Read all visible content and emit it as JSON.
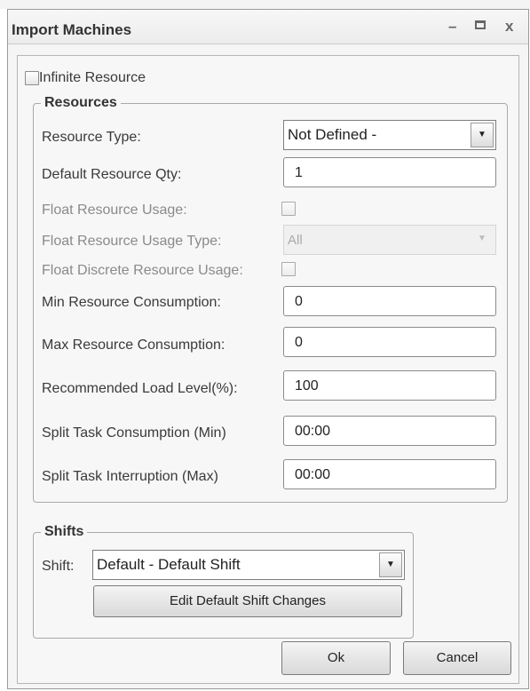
{
  "window": {
    "title": "Import Machines",
    "minimize_glyph": "–",
    "close_glyph": "x"
  },
  "infinite_resource": {
    "label": "Infinite Resource",
    "checked": false
  },
  "resources": {
    "legend": "Resources",
    "resource_type": {
      "label": "Resource Type:",
      "value": "Not Defined -"
    },
    "default_resource_qty": {
      "label": "Default Resource Qty:",
      "value": "1"
    },
    "float_resource_usage": {
      "label": "Float Resource Usage:",
      "checked": false
    },
    "float_resource_usage_type": {
      "label": "Float Resource Usage Type:",
      "value": "All",
      "disabled": true
    },
    "float_discrete_resource_usage": {
      "label": "Float Discrete Resource Usage:",
      "checked": false
    },
    "min_resource_consumption": {
      "label": "Min Resource Consumption:",
      "value": "0"
    },
    "max_resource_consumption": {
      "label": "Max Resource Consumption:",
      "value": "0"
    },
    "recommended_load_level": {
      "label": "Recommended Load Level(%):",
      "value": "100"
    },
    "split_task_consumption": {
      "label": "Split Task Consumption (Min)",
      "value": "00:00"
    },
    "split_task_interruption": {
      "label": "Split Task Interruption (Max)",
      "value": "00:00"
    }
  },
  "shifts": {
    "legend": "Shifts",
    "shift": {
      "label": "Shift:",
      "value": "Default - Default Shift"
    },
    "edit_button": "Edit Default Shift Changes"
  },
  "footer": {
    "ok": "Ok",
    "cancel": "Cancel"
  },
  "icons": {
    "dropdown": "▼"
  }
}
